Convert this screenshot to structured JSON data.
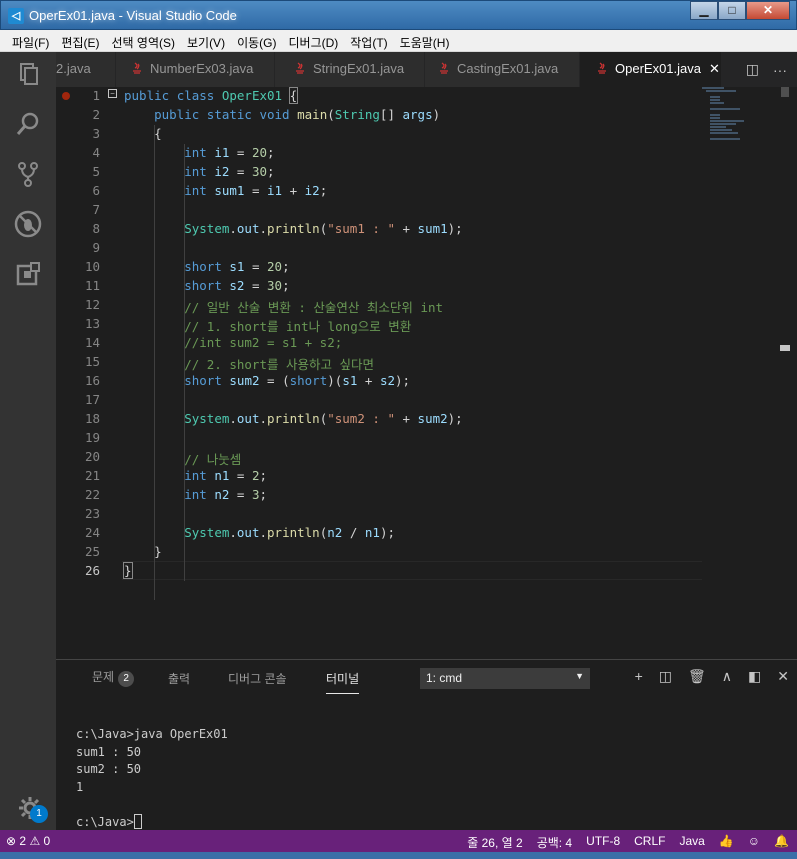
{
  "window": {
    "title": "OperEx01.java - Visual Studio Code",
    "min": "▁",
    "max": "□",
    "close": "✕"
  },
  "menu": [
    "파일(F)",
    "편집(E)",
    "선택 영역(S)",
    "보기(V)",
    "이동(G)",
    "디버그(D)",
    "작업(T)",
    "도움말(H)"
  ],
  "tabs": [
    {
      "label": "2.java"
    },
    {
      "label": "NumberEx03.java"
    },
    {
      "label": "StringEx01.java"
    },
    {
      "label": "CastingEx01.java"
    },
    {
      "label": "OperEx01.java",
      "active": true,
      "close": "✕"
    }
  ],
  "tab_actions": {
    "split": "◫",
    "more": "···"
  },
  "editor": {
    "line_numbers": [
      "1",
      "2",
      "3",
      "4",
      "5",
      "6",
      "7",
      "8",
      "9",
      "10",
      "11",
      "12",
      "13",
      "14",
      "15",
      "16",
      "17",
      "18",
      "19",
      "20",
      "21",
      "22",
      "23",
      "24",
      "25",
      "26"
    ],
    "fold_marker": "−"
  },
  "panel": {
    "tabs": {
      "problems": "문제",
      "problems_count": "2",
      "output": "출력",
      "debug_console": "디버그 콘솔",
      "terminal": "터미널"
    },
    "terminal_select": "1: cmd",
    "select_arrow": "▼",
    "icons": {
      "add": "+",
      "split": "◫",
      "trash": "🗑",
      "up": "∧",
      "maximize": "◧",
      "close": "✕"
    },
    "terminal_lines": [
      "c:\\Java>java OperEx01",
      "sum1 : 50",
      "sum2 : 50",
      "1",
      "",
      "c:\\Java>"
    ]
  },
  "activity": {
    "settings_badge": "1"
  },
  "status": {
    "errors": "2",
    "warnings": "0",
    "position": "줄 26, 열 2",
    "spaces": "공백: 4",
    "encoding": "UTF-8",
    "eol": "CRLF",
    "language": "Java",
    "accent": "#68217a"
  }
}
